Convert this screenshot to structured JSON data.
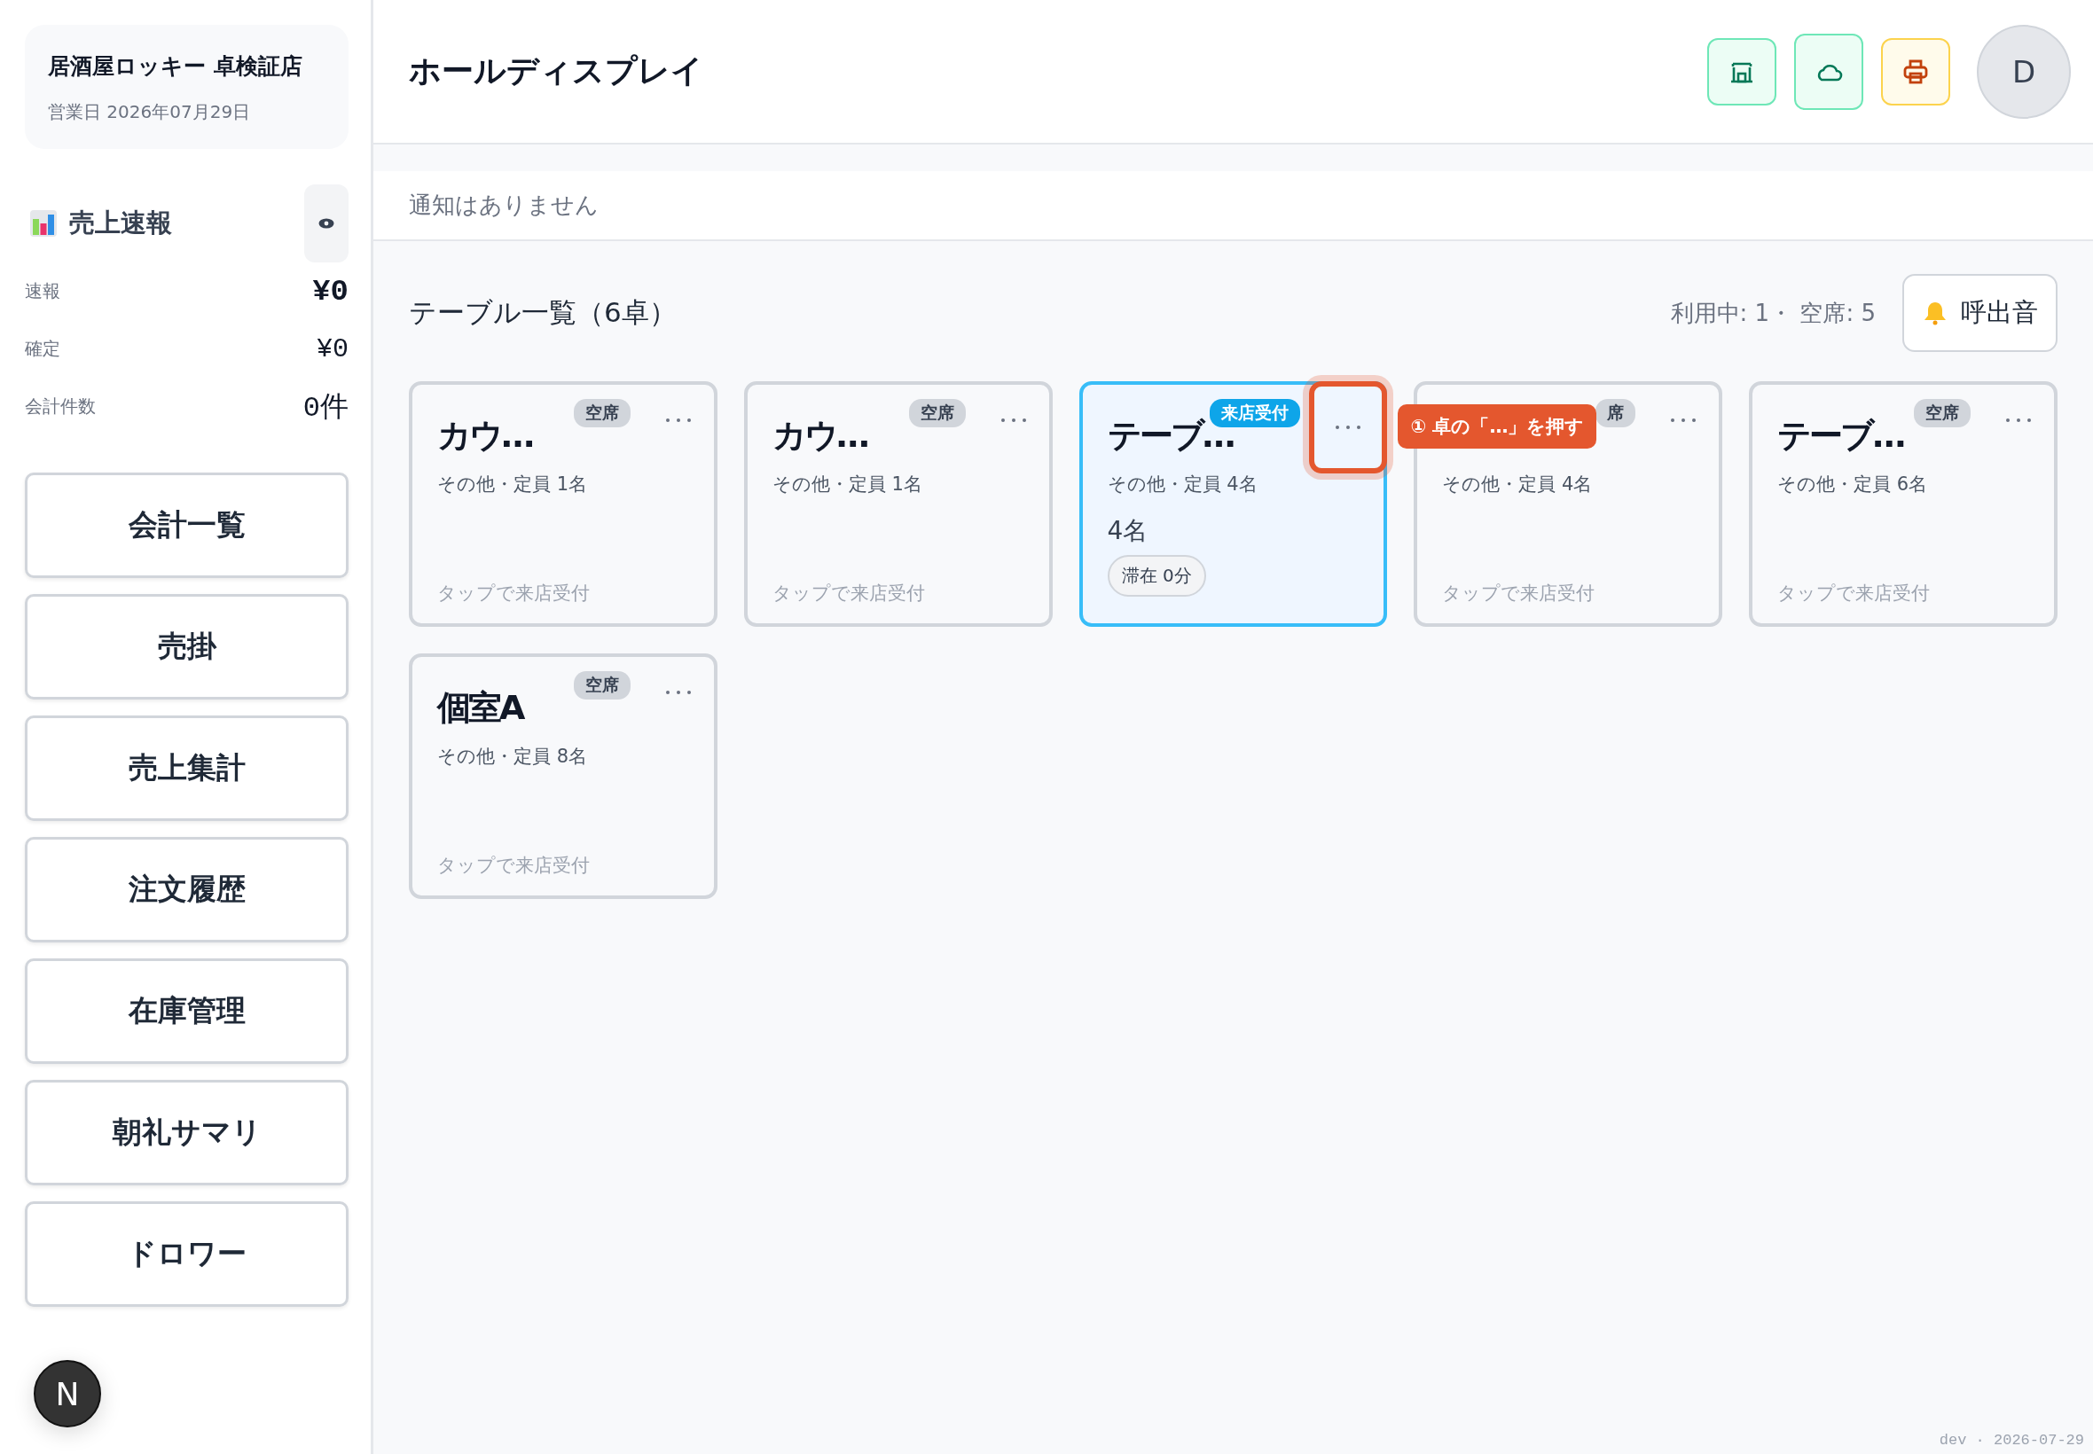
{
  "sidebar": {
    "store_name": "居酒屋ロッキー 卓検証店",
    "business_date": "営業日 2026年07月29日",
    "sales": {
      "title": "売上速報",
      "rows": [
        {
          "label": "速報",
          "value": "¥0",
          "kind": "headline"
        },
        {
          "label": "確定",
          "value": "¥0",
          "kind": "plain"
        },
        {
          "label": "会計件数",
          "value": "0件",
          "kind": "count"
        }
      ]
    },
    "nav": [
      "会計一覧",
      "売掛",
      "売上集計",
      "注文履歴",
      "在庫管理",
      "朝礼サマリ",
      "ドロワー"
    ],
    "dev_badge": "N"
  },
  "header": {
    "title": "ホールディスプレイ",
    "status_buttons": [
      {
        "kind": "store"
      },
      {
        "kind": "cloud"
      },
      {
        "kind": "printer"
      }
    ],
    "avatar": "D"
  },
  "notification": "通知はありません",
  "tables": {
    "title": "テーブル一覧（6卓）",
    "summary": "利用中: 1・ 空席: 5",
    "call_sound_button": "呼出音",
    "cards": [
      {
        "name": "カウ…",
        "status": "空席",
        "kind": "vacant",
        "selected": false,
        "menu_highlighted": false,
        "info": "その他・定員 1名",
        "hint": "タップで来店受付"
      },
      {
        "name": "カウ…",
        "status": "空席",
        "kind": "vacant",
        "selected": false,
        "menu_highlighted": false,
        "info": "その他・定員 1名",
        "hint": "タップで来店受付"
      },
      {
        "name": "テーブ…",
        "status": "来店受付",
        "kind": "occupied",
        "selected": true,
        "menu_highlighted": true,
        "info": "その他・定員 4名",
        "guests": "4名",
        "stay": "滞在 0分",
        "callout": "① 卓の「…」を押す"
      },
      {
        "status": "席",
        "kind": "vacant",
        "selected": false,
        "menu_highlighted": false,
        "info": "その他・定員 4名",
        "hint": "タップで来店受付"
      },
      {
        "name": "テーブ…",
        "status": "空席",
        "kind": "vacant",
        "selected": false,
        "menu_highlighted": false,
        "info": "その他・定員 6名",
        "hint": "タップで来店受付"
      },
      {
        "name": "個室A",
        "status": "空席",
        "kind": "vacant",
        "selected": false,
        "menu_highlighted": false,
        "info": "その他・定員 8名",
        "hint": "タップで来店受付"
      }
    ]
  },
  "footer": "dev · 2026-07-29"
}
